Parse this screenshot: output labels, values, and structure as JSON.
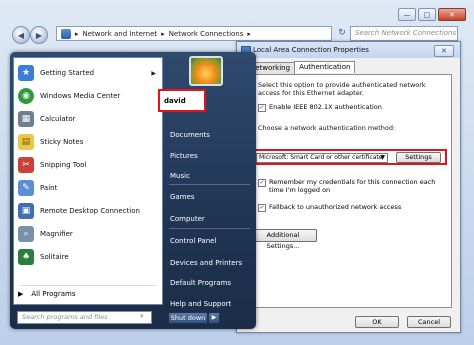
{
  "explorer": {
    "breadcrumb": [
      "Network and Internet",
      "Network Connections"
    ],
    "search_placeholder": "Search Network Connections"
  },
  "dialog": {
    "title": "Local Area Connection Properties",
    "tabs": [
      "Networking",
      "Authentication"
    ],
    "active_tab": "Authentication",
    "intro": "Select this option to provide authenticated network access for this Ethernet adapter.",
    "enable_8021x": {
      "label": "Enable IEEE 802.1X authentication",
      "checked": true
    },
    "method_label": "Choose a network authentication method:",
    "method_value": "Microsoft: Smart Card or other certificate",
    "settings_label": "Settings",
    "remember": {
      "label": "Remember my credentials for this connection each time I'm logged on",
      "checked": true
    },
    "fallback": {
      "label": "Fallback to unauthorized network access",
      "checked": true
    },
    "additional_label": "Additional Settings...",
    "ok_label": "OK",
    "cancel_label": "Cancel"
  },
  "start_menu": {
    "programs": [
      {
        "label": "Getting Started",
        "icon": "getting-started-icon",
        "color": "#3b7dd8",
        "submenu": true
      },
      {
        "label": "Windows Media Center",
        "icon": "media-center-icon",
        "color": "#2f9a3c",
        "submenu": false
      },
      {
        "label": "Calculator",
        "icon": "calculator-icon",
        "color": "#6d7f93",
        "submenu": false
      },
      {
        "label": "Sticky Notes",
        "icon": "sticky-notes-icon",
        "color": "#e8c84a",
        "submenu": false
      },
      {
        "label": "Snipping Tool",
        "icon": "snipping-tool-icon",
        "color": "#c9423a",
        "submenu": false
      },
      {
        "label": "Paint",
        "icon": "paint-icon",
        "color": "#5a8fd4",
        "submenu": false
      },
      {
        "label": "Remote Desktop Connection",
        "icon": "remote-desktop-icon",
        "color": "#3f6eb5",
        "submenu": false
      },
      {
        "label": "Magnifier",
        "icon": "magnifier-icon",
        "color": "#7a8fa8",
        "submenu": false
      },
      {
        "label": "Solitaire",
        "icon": "solitaire-icon",
        "color": "#2a7f3a",
        "submenu": false
      }
    ],
    "all_programs": "All Programs",
    "search_placeholder": "Search programs and files",
    "user": "david",
    "right_items": [
      "Documents",
      "Pictures",
      "Music",
      "Games",
      "Computer",
      "Control Panel",
      "Devices and Printers",
      "Default Programs",
      "Help and Support"
    ],
    "shutdown_label": "Shut down"
  }
}
